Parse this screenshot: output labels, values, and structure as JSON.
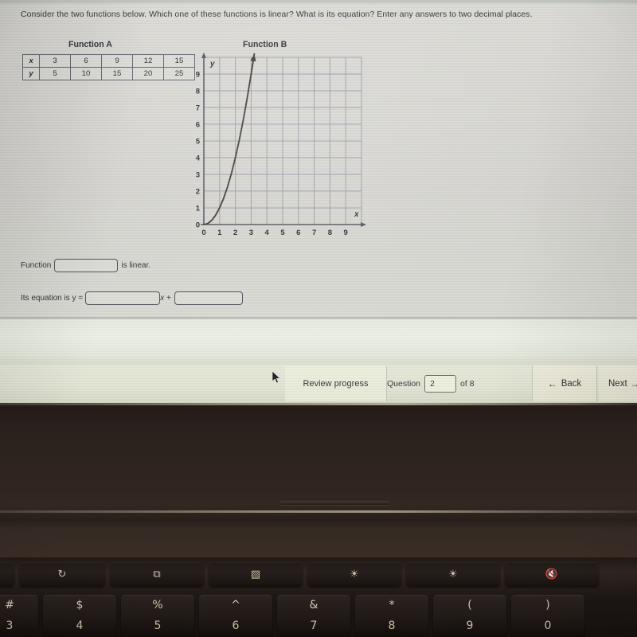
{
  "question": {
    "prompt": "Consider the two functions below. Which one of these functions is linear? What is its equation? Enter any answers to two decimal places."
  },
  "function_a": {
    "title": "Function A",
    "row_headers": [
      "x",
      "y"
    ],
    "x_values": [
      "3",
      "6",
      "9",
      "12",
      "15"
    ],
    "y_values": [
      "5",
      "10",
      "15",
      "20",
      "25"
    ]
  },
  "function_b": {
    "title": "Function B",
    "x_axis_label": "x",
    "y_axis_label": "y",
    "x_ticks": [
      "0",
      "1",
      "2",
      "3",
      "4",
      "5",
      "6",
      "7",
      "8",
      "9"
    ],
    "y_ticks": [
      "0",
      "1",
      "2",
      "3",
      "4",
      "5",
      "6",
      "7",
      "8",
      "9"
    ]
  },
  "chart_data": {
    "type": "line",
    "title": "Function B",
    "xlabel": "x",
    "ylabel": "y",
    "xlim": [
      0,
      10
    ],
    "ylim": [
      0,
      10
    ],
    "grid": true,
    "legend": "none",
    "x_ticks": [
      0,
      1,
      2,
      3,
      4,
      5,
      6,
      7,
      8,
      9
    ],
    "y_ticks": [
      0,
      1,
      2,
      3,
      4,
      5,
      6,
      7,
      8,
      9
    ],
    "series": [
      {
        "name": "Function B",
        "description": "Increasing curve through origin, concave up, ending with an upward arrow near x = 3.2",
        "arrow_end": true,
        "x": [
          0.0,
          0.25,
          0.5,
          0.75,
          1.0,
          1.25,
          1.5,
          1.75,
          2.0,
          2.25,
          2.5,
          2.75,
          3.0,
          3.2
        ],
        "y": [
          0.0,
          0.06,
          0.25,
          0.56,
          1.0,
          1.56,
          2.25,
          3.06,
          4.0,
          5.06,
          6.25,
          7.56,
          9.0,
          10.2
        ]
      }
    ]
  },
  "answers": {
    "line1_prefix": "Function",
    "line1_suffix": "is linear.",
    "function_name_value": "",
    "function_name_placeholder": "",
    "line2_prefix": "Its equation is y =",
    "slope_value": "",
    "slope_placeholder": "",
    "middle_text": "x +",
    "intercept_value": "",
    "intercept_placeholder": ""
  },
  "toolbar": {
    "review_progress_label": "Review progress",
    "question_label": "Question",
    "question_number": "2",
    "of_label": "of 8",
    "back_label": "Back",
    "back_arrow": "←",
    "next_label": "Next",
    "next_arrow": "→"
  },
  "keyboard": {
    "function_keys": [
      {
        "name": "refresh-key",
        "glyph": "↻"
      },
      {
        "name": "fullscreen-key",
        "glyph": "⧉"
      },
      {
        "name": "window-overview-key",
        "glyph": "▧"
      },
      {
        "name": "brightness-down-key",
        "glyph": "☀"
      },
      {
        "name": "brightness-up-key",
        "glyph": "☀"
      },
      {
        "name": "mute-key",
        "glyph": "🔇"
      }
    ],
    "number_keys": [
      {
        "symbol": "#",
        "number": "3"
      },
      {
        "symbol": "$",
        "number": "4"
      },
      {
        "symbol": "%",
        "number": "5"
      },
      {
        "symbol": "^",
        "number": "6"
      },
      {
        "symbol": "&",
        "number": "7"
      },
      {
        "symbol": "*",
        "number": "8"
      },
      {
        "symbol": "(",
        "number": "9"
      },
      {
        "symbol": ")",
        "number": "0"
      }
    ]
  },
  "colors": {
    "screen_background": "#d6d5d0",
    "toolbar_background": "#e4e7d6",
    "grid_line": "#8b93a3",
    "curve": "#3a3630",
    "text": "#2f3136"
  }
}
